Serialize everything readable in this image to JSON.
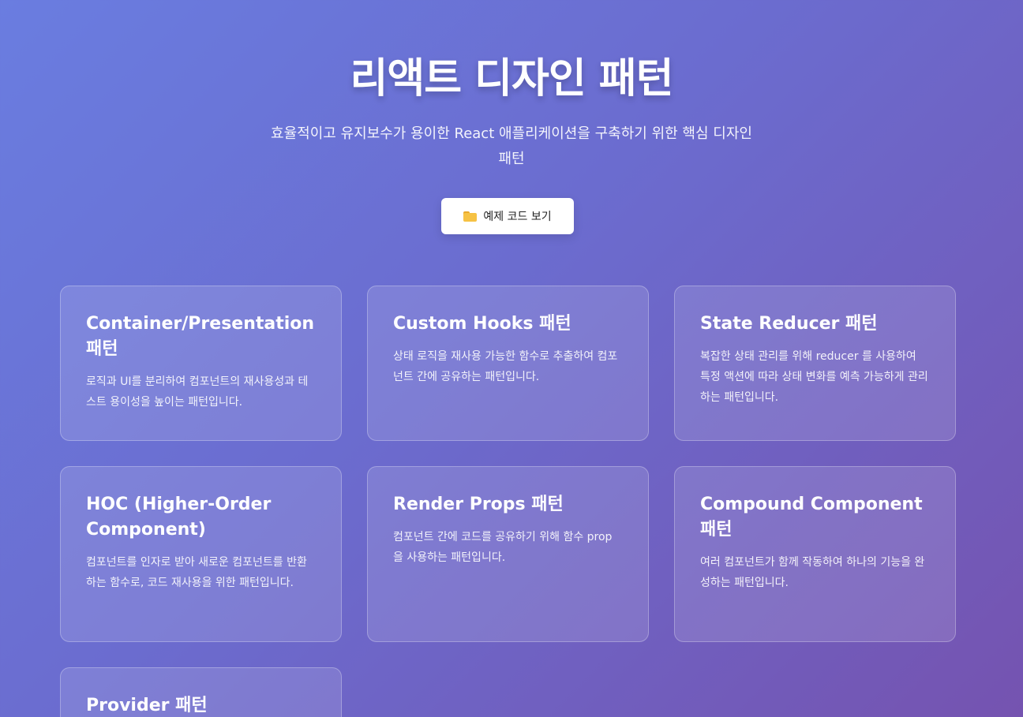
{
  "hero": {
    "title": "리액트 디자인 패턴",
    "subtitle": "효율적이고 유지보수가 용이한 React 애플리케이션을 구축하기 위한 핵심 디자인 패턴",
    "button_icon": "folder-icon",
    "button_label": "예제 코드 보기"
  },
  "patterns": [
    {
      "title": "Container/Presentation 패턴",
      "description": "로직과 UI를 분리하여 컴포넌트의 재사용성과 테스트 용이성을 높이는 패턴입니다."
    },
    {
      "title": "Custom Hooks 패턴",
      "description": "상태 로직을 재사용 가능한 함수로 추출하여 컴포넌트 간에 공유하는 패턴입니다."
    },
    {
      "title": "State Reducer 패턴",
      "description": "복잡한 상태 관리를 위해 reducer 를 사용하여 특정 액션에 따라 상태 변화를 예측 가능하게 관리하는 패턴입니다."
    },
    {
      "title": "HOC (Higher-Order Component)",
      "description": "컴포넌트를 인자로 받아 새로운 컴포넌트를 반환하는 함수로, 코드 재사용을 위한 패턴입니다."
    },
    {
      "title": "Render Props 패턴",
      "description": "컴포넌트 간에 코드를 공유하기 위해 함수 prop 을 사용하는 패턴입니다."
    },
    {
      "title": "Compound Component 패턴",
      "description": "여러 컴포넌트가 함께 작동하여 하나의 기능을 완성하는 패턴입니다."
    },
    {
      "title": "Provider 패턴",
      "description": ""
    }
  ]
}
